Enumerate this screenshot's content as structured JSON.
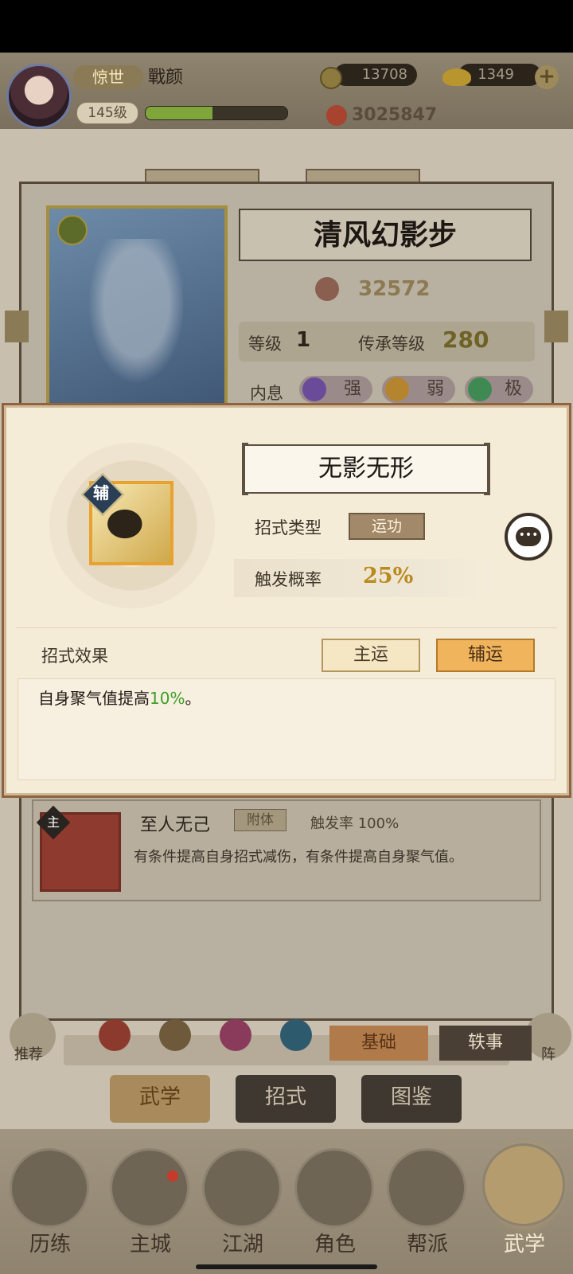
{
  "player": {
    "vip": "惊世",
    "name": "戰颜",
    "level": "145级",
    "xp_progress": 0.47,
    "coins": "13708",
    "ingots": "1349",
    "power": "3025847"
  },
  "skill_card": {
    "title": "清风幻影步",
    "power": "32572",
    "level_label": "等级",
    "level_value": "1",
    "inherit_label": "传承等级",
    "inherit_value": "280",
    "inner_label": "内息",
    "attrs": [
      {
        "label": "强",
        "color": "#6a4b9a"
      },
      {
        "label": "弱",
        "color": "#b5842e"
      },
      {
        "label": "极",
        "color": "#3f8a52"
      }
    ]
  },
  "modal": {
    "badge": "辅",
    "move_name": "无影无形",
    "type_label": "招式类型",
    "type_value": "运功",
    "rate_label": "触发概率",
    "rate_value": "25%",
    "effect_label": "招式效果",
    "tab_main": "主运",
    "tab_assist": "辅运",
    "effect_text_before": "自身聚气值提高",
    "effect_highlight": "10%",
    "effect_text_after": "。"
  },
  "lower_skill": {
    "badge": "主",
    "name": "至人无己",
    "tag": "附体",
    "rate": "触发率 100%",
    "desc": "有条件提高自身招式减伤，有条件提高自身聚气值。"
  },
  "bottom_tabs": {
    "left_label": "推荐",
    "right_label": "阵",
    "basic": "基础",
    "anecdote": "轶事"
  },
  "categories": [
    "武学",
    "招式",
    "图鉴"
  ],
  "nav": [
    "历练",
    "主城",
    "江湖",
    "角色",
    "帮派",
    "武学"
  ]
}
